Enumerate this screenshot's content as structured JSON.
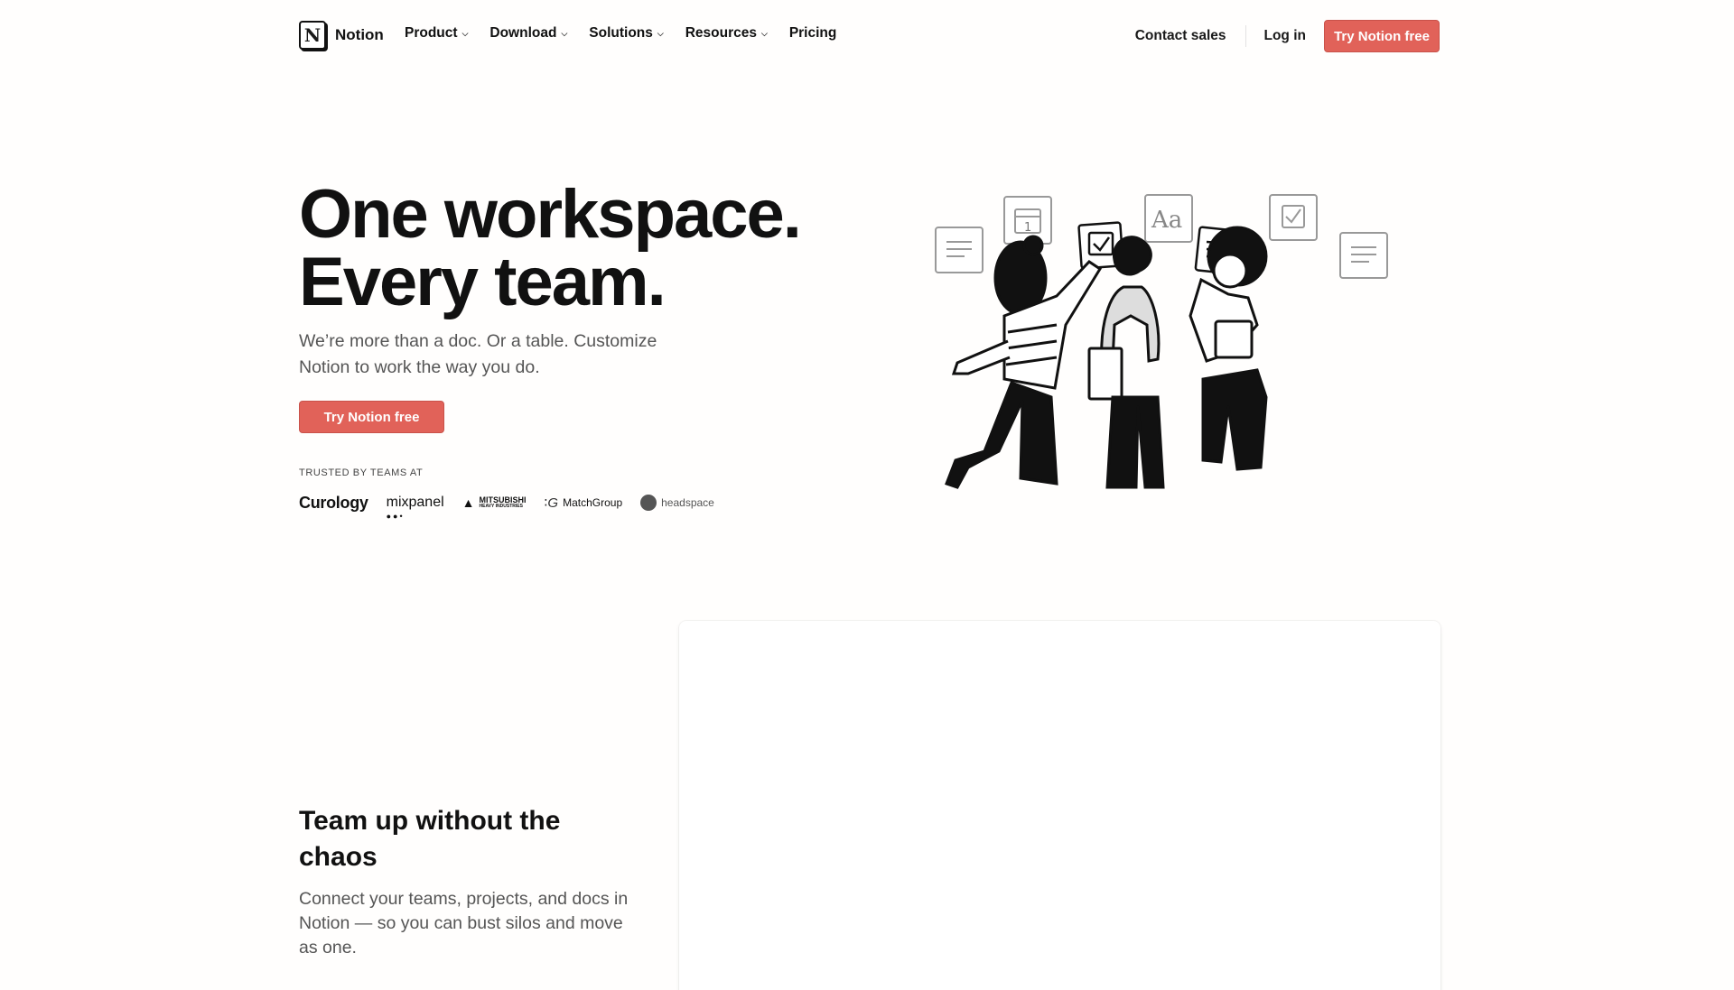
{
  "nav": {
    "logo_text": "Notion",
    "logo_glyph": "N",
    "links": [
      {
        "label": "Product",
        "has_dropdown": true
      },
      {
        "label": "Download",
        "has_dropdown": true
      },
      {
        "label": "Solutions",
        "has_dropdown": true
      },
      {
        "label": "Resources",
        "has_dropdown": true
      },
      {
        "label": "Pricing",
        "has_dropdown": false
      }
    ],
    "contact_sales": "Contact sales",
    "log_in": "Log in",
    "cta": "Try Notion free"
  },
  "hero": {
    "title_line1": "One workspace.",
    "title_line2": "Every team.",
    "subtitle": "We’re more than a doc. Or a table. Customize Notion to work the way you do.",
    "cta": "Try Notion free",
    "trusted_label": "TRUSTED BY TEAMS AT",
    "logos": {
      "curology": "Curology",
      "mixpanel": "mixpanel",
      "mitsubishi_1": "MITSUBISHI",
      "mitsubishi_2": "HEAVY INDUSTRIES",
      "matchgroup": "MatchGroup",
      "headspace": "headspace"
    },
    "illustration_text": {
      "calendar_num": "1",
      "font_sample": "Aa"
    }
  },
  "section2": {
    "title": "Team up without the chaos",
    "body": "Connect your teams, projects, and docs in Notion — so you can bust silos and move as one."
  },
  "colors": {
    "accent": "#e16259",
    "text": "#191919",
    "muted": "#555555",
    "background": "#fffefd"
  },
  "icons": [
    "chevron-down-icon",
    "notion-logo-icon",
    "document-icon",
    "calendar-icon",
    "checkbox-icon",
    "text-icon"
  ]
}
